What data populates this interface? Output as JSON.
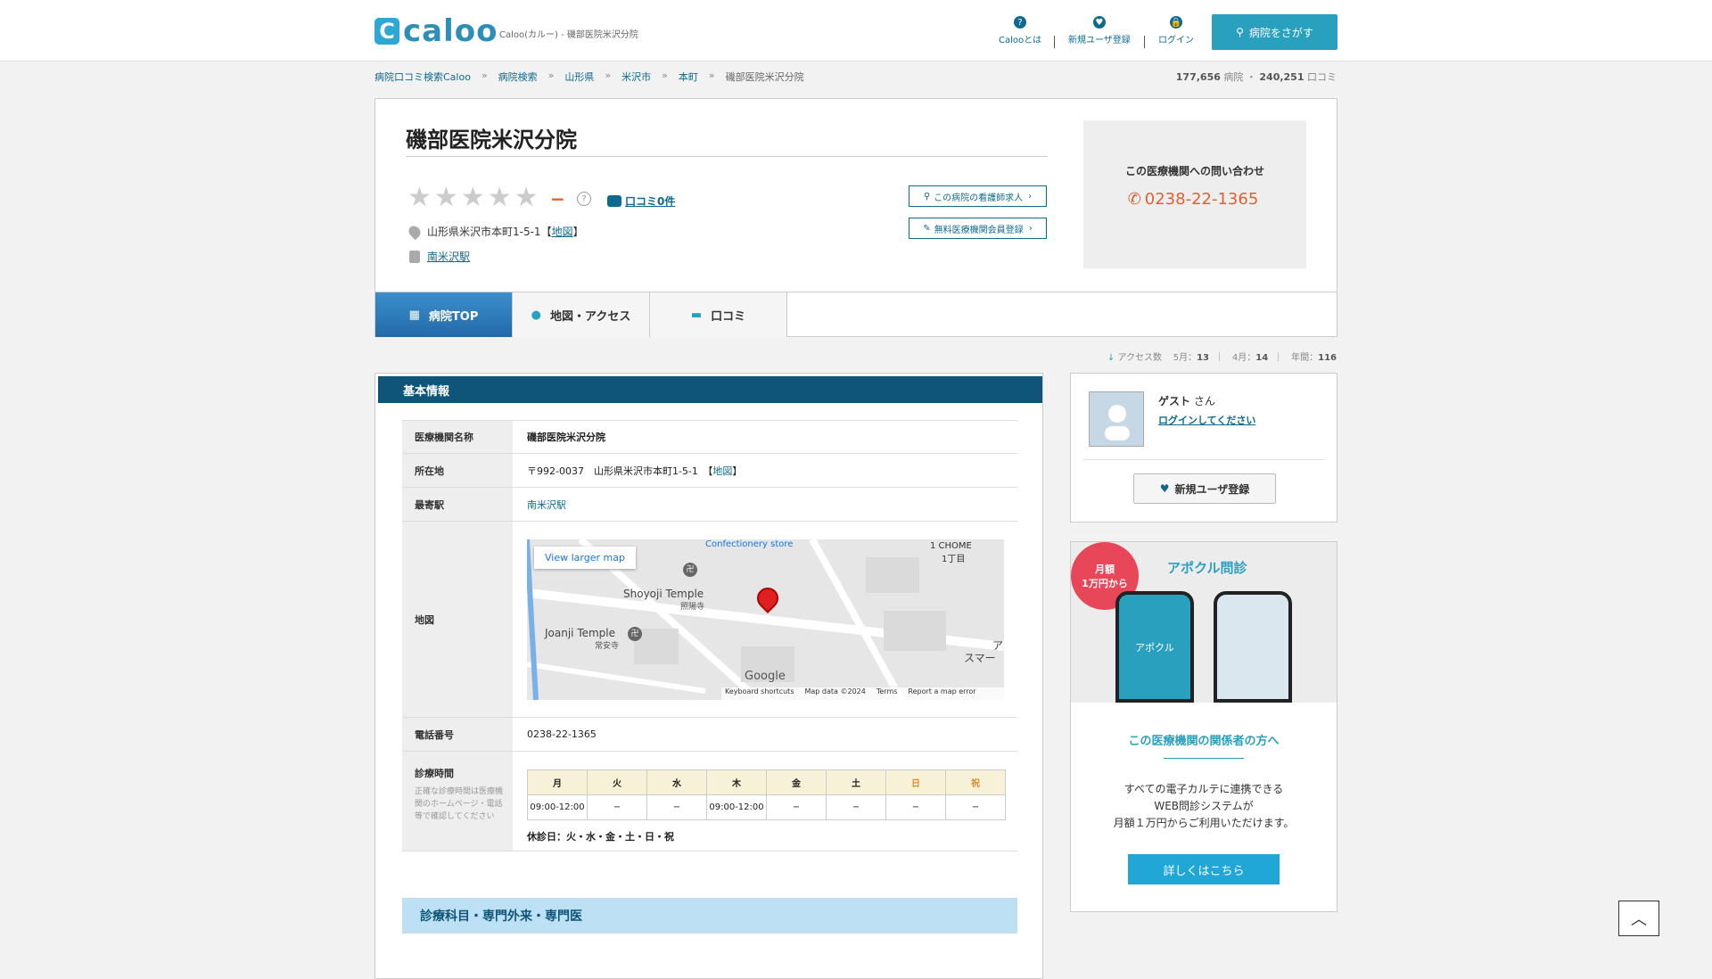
{
  "header": {
    "logo_mark": "C",
    "logo_text": "caloo",
    "logo_sub": "Caloo(カルー) - 磯部医院米沢分院",
    "nav": [
      {
        "label": "Calooとは",
        "icon": "?"
      },
      {
        "label": "新規ユーザ登録",
        "icon": "♥"
      },
      {
        "label": "ログイン",
        "icon": "🔒"
      }
    ],
    "search_button": "病院をさがす"
  },
  "breadcrumb": [
    "病院口コミ検索Caloo",
    "病院検索",
    "山形県",
    "米沢市",
    "本町",
    "磯部医院米沢分院"
  ],
  "counts": {
    "hospitals": "177,656",
    "hospitals_label": "病院 ・",
    "reviews": "240,251",
    "reviews_label": "口コミ"
  },
  "hospital": {
    "name": "磯部医院米沢分院",
    "rating_dash": "−",
    "help": "?",
    "review_link": "口コミ0件",
    "address": "山形県米沢市本町1-5-1【",
    "map_link": "地図",
    "address_end": "】",
    "station": "南米沢駅",
    "nurse_button": "この病院の看護師求人",
    "register_button": "無料医療機関会員登録",
    "contact_title": "この医療機関への問い合わせ",
    "phone": "0238-22-1365"
  },
  "tabs": [
    {
      "label": "病院TOP"
    },
    {
      "label": "地図・アクセス"
    },
    {
      "label": "口コミ"
    }
  ],
  "access": {
    "label": "アクセス数",
    "may": "5月：",
    "may_v": "13",
    "apr": "4月：",
    "apr_v": "14",
    "year": "年間：",
    "year_v": "116"
  },
  "basic": {
    "title": "基本情報",
    "rows": {
      "name_k": "医療機関名称",
      "name_v": "磯部医院米沢分院",
      "addr_k": "所在地",
      "addr_v": "〒992-0037　山形県米沢市本町1-5-1　【",
      "addr_link": "地図",
      "addr_end": "】",
      "station_k": "最寄駅",
      "station_v": "南米沢駅",
      "map_k": "地図",
      "tel_k": "電話番号",
      "tel_v": "0238-22-1365",
      "hours_k": "診療時間",
      "hours_note": "正確な診療時間は医療機関のホームページ・電話等で確認してください"
    },
    "map": {
      "view_larger": "View larger map",
      "confectionery": "Confectionery store",
      "chome": "1 CHOME",
      "chome2": "1丁目",
      "shoyoji": "Shoyoji Temple",
      "shoyoji_jp": "照陽寺",
      "joanji": "Joanji Temple",
      "joanji_jp": "常安寺",
      "google": "Google",
      "shortcuts": "Keyboard shortcuts",
      "mapdata": "Map data ©2024",
      "terms": "Terms",
      "report": "Report a map error",
      "sumare": "スマー",
      "a": "ア"
    },
    "schedule": {
      "days": [
        "月",
        "火",
        "水",
        "木",
        "金",
        "土",
        "日",
        "祝"
      ],
      "times": [
        "09:00-12:00",
        "−",
        "−",
        "09:00-12:00",
        "−",
        "−",
        "−",
        "−"
      ],
      "closed": "休診日：火・水・金・土・日・祝"
    }
  },
  "dept_title": "診療科目・専門外来・専門医",
  "user": {
    "name": "ゲスト",
    "suffix": "さん",
    "login": "ログインしてください",
    "register": "新規ユーザ登録"
  },
  "ad": {
    "badge1": "月額",
    "badge2": "1万円から",
    "brand": "アポクル問診",
    "phone_label": "アポクル",
    "title": "この医療機関の関係者の方へ",
    "line1": "すべての電子カルテに連携できる",
    "line2": "WEB問診システムが",
    "line3": "月額１万円からご利用いただけます。",
    "button": "詳しくはこちら"
  },
  "scroll_top": "︿",
  "colors": {
    "accent": "#2aa0bf",
    "header_dark": "#0e5579",
    "link": "#0e6a8e",
    "rating_dash": "#e06030"
  }
}
